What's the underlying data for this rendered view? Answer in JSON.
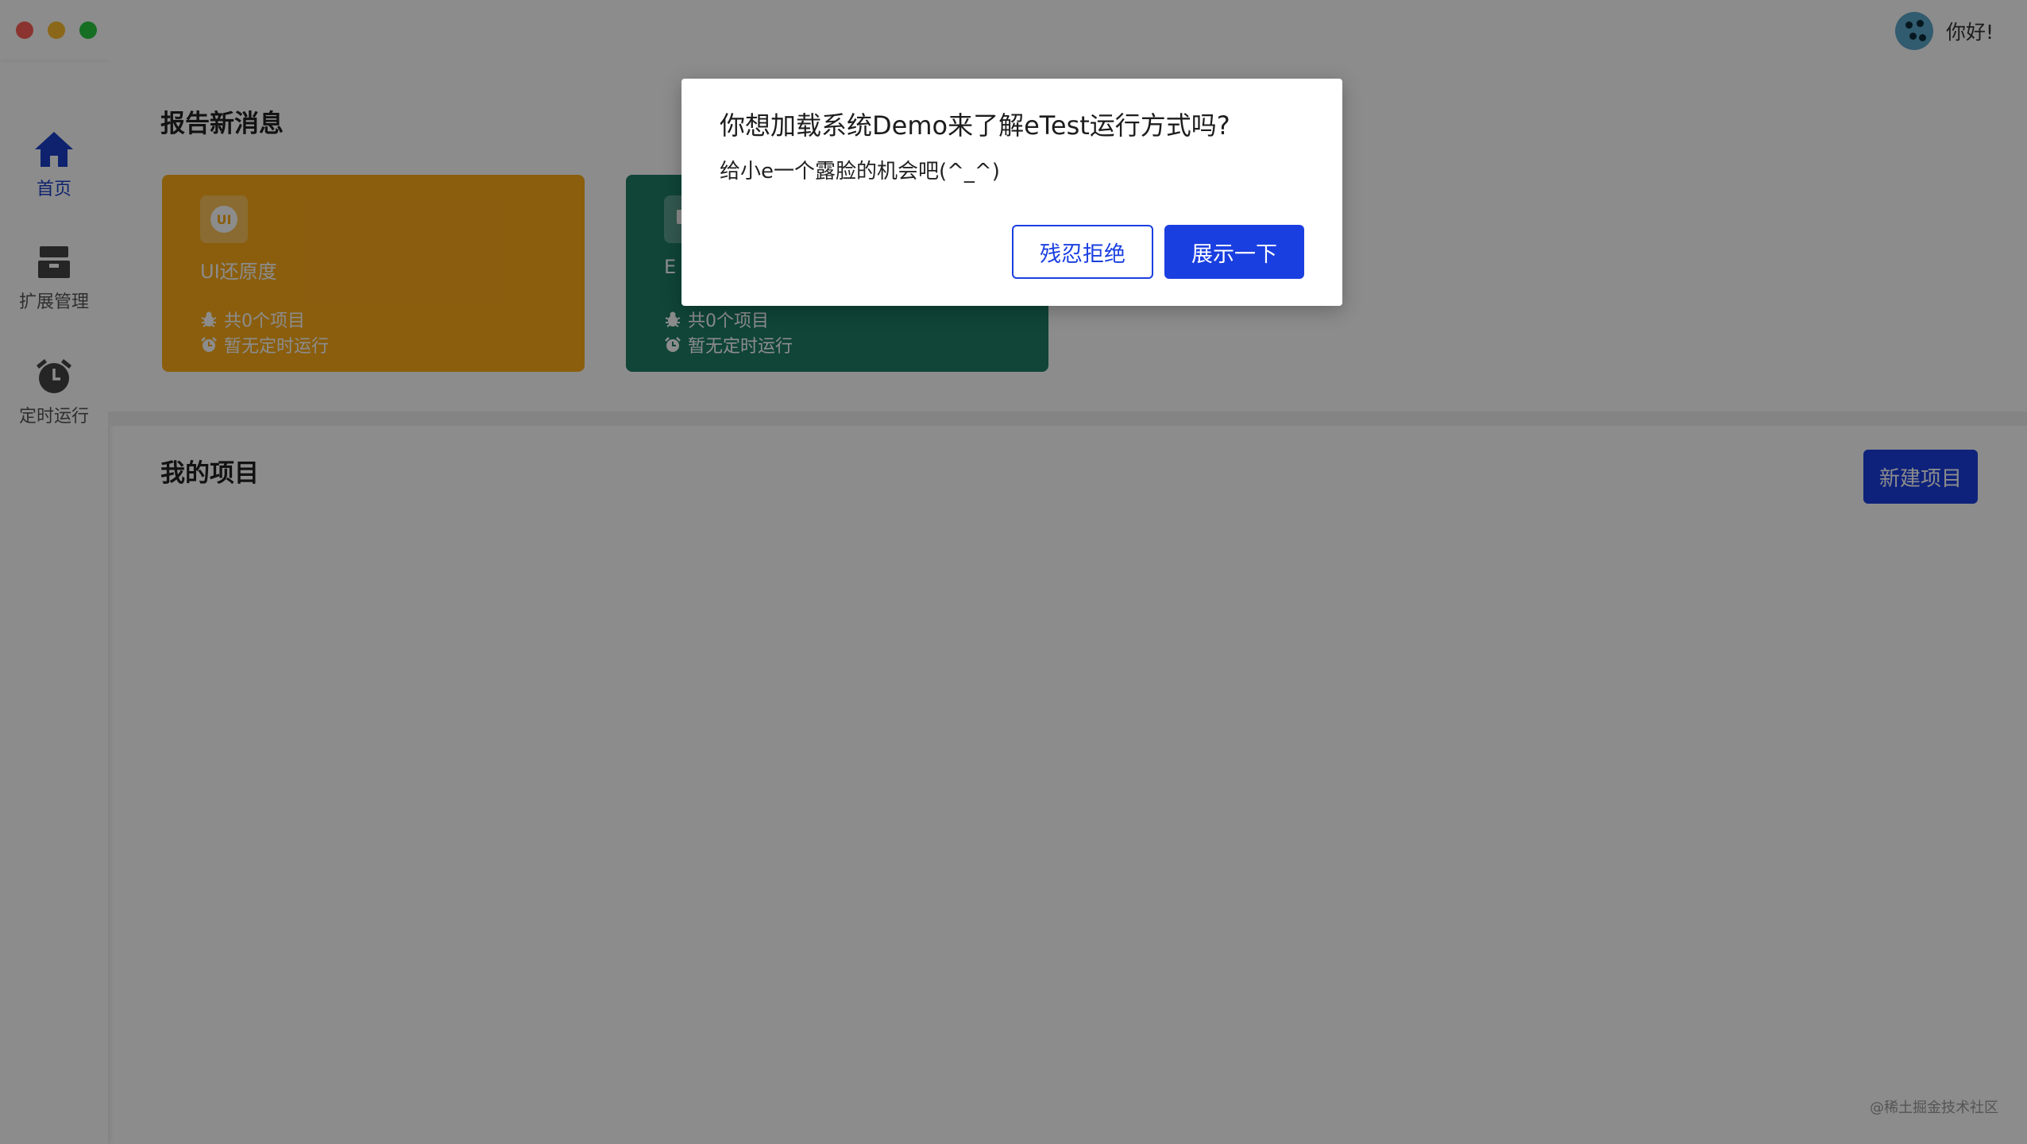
{
  "header": {
    "greeting": "你好!"
  },
  "sidebar": {
    "items": [
      {
        "label": "首页",
        "icon": "home-icon",
        "active": true
      },
      {
        "label": "扩展管理",
        "icon": "archive-box-icon",
        "active": false
      },
      {
        "label": "定时运行",
        "icon": "alarm-clock-icon",
        "active": false
      }
    ]
  },
  "reports": {
    "title": "报告新消息",
    "cards": [
      {
        "icon_text": "UI",
        "title": "UI还原度",
        "projects": "共0个项目",
        "schedule": "暂无定时运行",
        "color": "#fbac19"
      },
      {
        "title": "E",
        "projects": "共0个项目",
        "schedule": "暂无定时运行",
        "color": "#1e7f67"
      }
    ]
  },
  "projects": {
    "title": "我的项目",
    "new_button": "新建项目"
  },
  "modal": {
    "title": "你想加载系统Demo来了解eTest运行方式吗?",
    "body": "给小e一个露脸的机会吧(^_^)",
    "reject_label": "残忍拒绝",
    "confirm_label": "展示一下"
  },
  "watermark": "@稀土掘金技术社区",
  "colors": {
    "accent": "#1a3fe0",
    "overlay": "rgba(0,0,0,0.45)"
  }
}
